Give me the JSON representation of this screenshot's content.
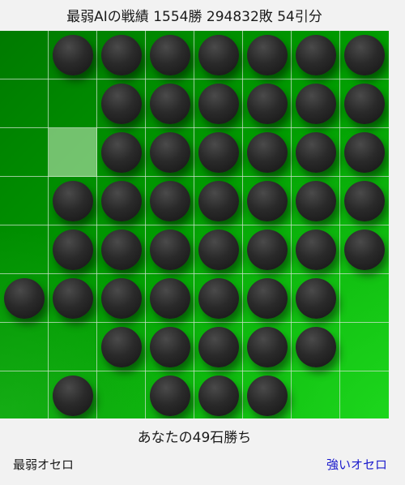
{
  "record": {
    "label": "最弱AIの戦績",
    "wins": "1554勝",
    "losses": "294832敗",
    "draws": "54引分"
  },
  "board": {
    "size": 8,
    "rows": [
      "-BBBBBBB",
      "--BBBBBB",
      "-*BBBBBB",
      "-BBBBBBB",
      "-BBBBBBB",
      "BBBBBBB-",
      "--BBBBB-",
      "-B-BBB--"
    ],
    "legend": {
      "B": "black-stone",
      "-": "empty",
      "*": "highlighted-empty"
    }
  },
  "result_text": "あなたの49石勝ち",
  "links": {
    "weakest": "最弱オセロ",
    "strong": "強いオセロ"
  },
  "colors": {
    "board_dark": "#007a00",
    "board_light": "#0fc20f",
    "link_blue": "#1a1acc",
    "hint_cell": "#8fd68f"
  }
}
